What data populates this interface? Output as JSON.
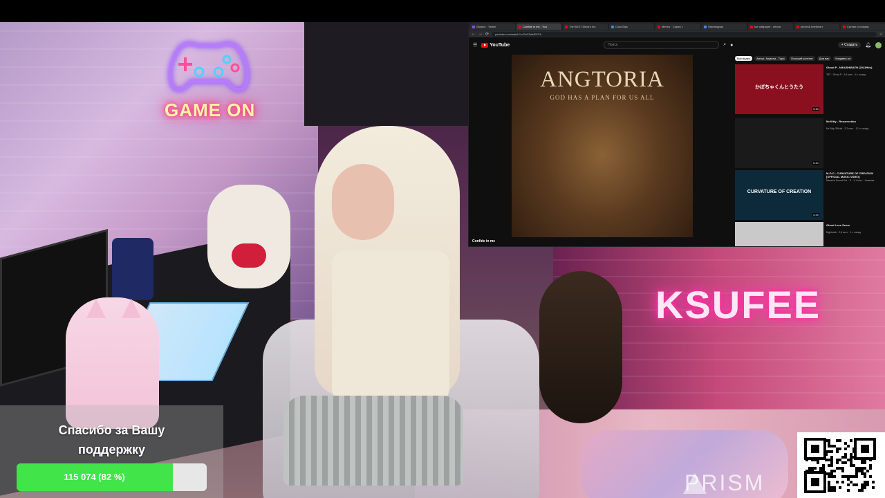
{
  "browser": {
    "tabs": [
      {
        "label": "Studios · Twitch",
        "color": "#9146ff"
      },
      {
        "label": "Confide in me - You",
        "color": "#ff0000",
        "active": true
      },
      {
        "label": "The BEST Electro Ins",
        "color": "#ff0000"
      },
      {
        "label": "CloudTips",
        "color": "#3b82f6"
      },
      {
        "label": "Мечты · Серия 1",
        "color": "#ff0000"
      },
      {
        "label": "Переводчик",
        "color": "#4285f4"
      },
      {
        "label": "Ice wallpaper - песня",
        "color": "#ff0000"
      },
      {
        "label": "pieces8 плейлист",
        "color": "#ff0000"
      },
      {
        "label": "Сигнал и отзывы",
        "color": "#ff0000"
      }
    ],
    "url": "youtube.com/watch?v=PhCWtsRiYF6",
    "youtube": {
      "logo": "YouTube",
      "search_placeholder": "Поиск",
      "create_label": "+ Создать",
      "video_caption": "Confide in me",
      "album": {
        "title": "ANGTORIA",
        "subtitle": "GOD HAS A PLAN FOR US ALL"
      },
      "chips": [
        "Все видео",
        "Автор: Angtoria - Topic",
        "Похожий контент",
        "Для вас",
        "Недавно оп"
      ],
      "recommendations": [
        {
          "title": "Ghost P - NIKUSHIBATH [2023Hits]",
          "meta": "TBT · Ghost P · 2,5 млн. · 4 г. назад",
          "duration": "3:35",
          "thumb_text": "かぼちゃくんとうたう",
          "thumb_color": "#8a1020"
        },
        {
          "title": "Mr.Kitty - Resurrection",
          "meta": "Mr.Kitty Official · 2,2 млн. · 12 л. назад",
          "duration": "5:40",
          "thumb_text": "",
          "thumb_color": "#1a1a1a"
        },
        {
          "title": "M.O.O - CURVATURE OF CREATION [OFFICIAL MUSIC VIDEO]",
          "meta": "Massive Sound Ent. · 8 · 1,1 млн. · Новинка",
          "duration": "3:34",
          "thumb_text": "CURVATURE OF CREATION",
          "thumb_color": "#0d2a3a"
        },
        {
          "title": "Ghost Love Score",
          "meta": "Nightwish · 2,5 млн. · 1 г. назад",
          "duration": "",
          "thumb_text": "",
          "thumb_color": "#c9c9c9"
        }
      ]
    }
  },
  "stream": {
    "neon_sign_left": "GAME ON",
    "neon_sign_right": "KSUFEE",
    "brand": "PRISM"
  },
  "donation": {
    "message": "Спасибо за Вашу\nподдержку",
    "progress_label": "115 074 (82 %)",
    "progress_fraction": 0.82
  },
  "icons": {
    "gamepad": "gamepad-neon-icon",
    "qr": "qr-code"
  }
}
